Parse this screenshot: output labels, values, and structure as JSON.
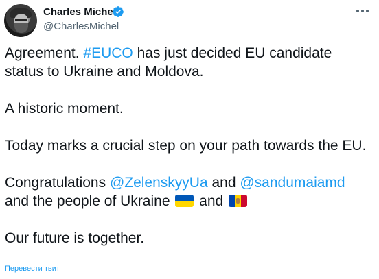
{
  "author": {
    "name": "Charles Michel",
    "handle": "@CharlesMichel",
    "verified": true,
    "verified_color": "#1d9bf0"
  },
  "tweet": {
    "line1_pre": "Agreement. ",
    "line1_hashtag": "#EUCO",
    "line1_post": " has just decided EU candidate status to Ukraine and Moldova.",
    "line2": "A historic moment.",
    "line3": "Today marks a crucial step on your path towards the EU.",
    "line4_pre": "Congratulations ",
    "line4_mention1": "@ZelenskyyUa",
    "line4_and": " and ",
    "line4_mention2": "@sandumaiamd",
    "line4_post": " and the people of Ukraine ",
    "line4_and2": " and ",
    "line5": "Our future is together."
  },
  "flags": {
    "ukraine": "flag-ukraine-icon",
    "moldova": "flag-moldova-icon"
  },
  "translate_link": "Перевести твит",
  "colors": {
    "link": "#1d9bf0",
    "text": "#0f1419",
    "secondary": "#536471"
  }
}
